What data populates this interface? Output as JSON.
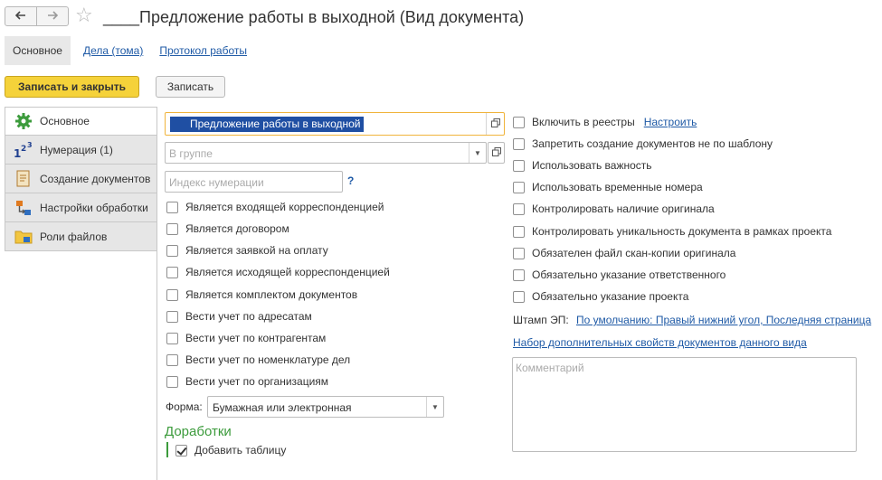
{
  "header": {
    "back_icon": "arrow-left-icon",
    "forward_icon": "arrow-right-icon",
    "favorite_icon": "star-icon",
    "title": "____Предложение работы в выходной (Вид документа)"
  },
  "tabs": [
    {
      "label": "Основное",
      "active": true
    },
    {
      "label": "Дела (тома)"
    },
    {
      "label": "Протокол работы"
    }
  ],
  "toolbar": {
    "save_close": "Записать и закрыть",
    "save": "Записать",
    "primary_color": "#f5d23a"
  },
  "sidebar": {
    "items": [
      {
        "label": "Основное",
        "icon": "gear-icon",
        "active": true
      },
      {
        "label": "Нумерация (1)",
        "icon": "numbering-icon"
      },
      {
        "label": "Создание документов",
        "icon": "document-icon"
      },
      {
        "label": "Настройки обработки",
        "icon": "process-icon"
      },
      {
        "label": "Роли файлов",
        "icon": "folder-icon"
      }
    ]
  },
  "form": {
    "name_value": "Предложение работы в выходной",
    "group_placeholder": "В группе",
    "index_placeholder": "Индекс нумерации",
    "help": "?",
    "left_checkboxes": [
      {
        "label": "Является входящей корреспонденцией",
        "checked": false
      },
      {
        "label": "Является договором",
        "checked": false
      },
      {
        "label": "Является заявкой на оплату",
        "checked": false
      },
      {
        "label": "Является исходящей корреспонденцией",
        "checked": false
      },
      {
        "label": "Является комплектом документов",
        "checked": false
      },
      {
        "label": "Вести учет по адресатам",
        "checked": false
      },
      {
        "label": "Вести учет по контрагентам",
        "checked": false
      },
      {
        "label": "Вести учет по номенклатуре дел",
        "checked": false
      },
      {
        "label": "Вести учет по организациям",
        "checked": false
      }
    ],
    "forma_label": "Форма:",
    "forma_value": "Бумажная или электронная",
    "dorabotki_title": "Доработки",
    "add_table": {
      "label": "Добавить таблицу",
      "checked": true
    },
    "include_registers": "Включить в реестры",
    "configure_link": "Настроить",
    "right_checkboxes": [
      {
        "label": "Запретить создание документов не по шаблону",
        "checked": false
      },
      {
        "label": "Использовать важность",
        "checked": false
      },
      {
        "label": "Использовать временные номера",
        "checked": false
      },
      {
        "label": "Контролировать наличие оригинала",
        "checked": false
      },
      {
        "label": "Контролировать уникальность документа в рамках проекта",
        "checked": false
      },
      {
        "label": "Обязателен файл скан-копии оригинала",
        "checked": false
      },
      {
        "label": "Обязательно указание ответственного",
        "checked": false
      },
      {
        "label": "Обязательно указание проекта",
        "checked": false
      }
    ],
    "stamp_label": "Штамп ЭП:",
    "stamp_link": "По умолчанию: Правый нижний угол, Последняя страница",
    "props_link": "Набор дополнительных свойств документов данного вида",
    "comment_placeholder": "Комментарий"
  }
}
